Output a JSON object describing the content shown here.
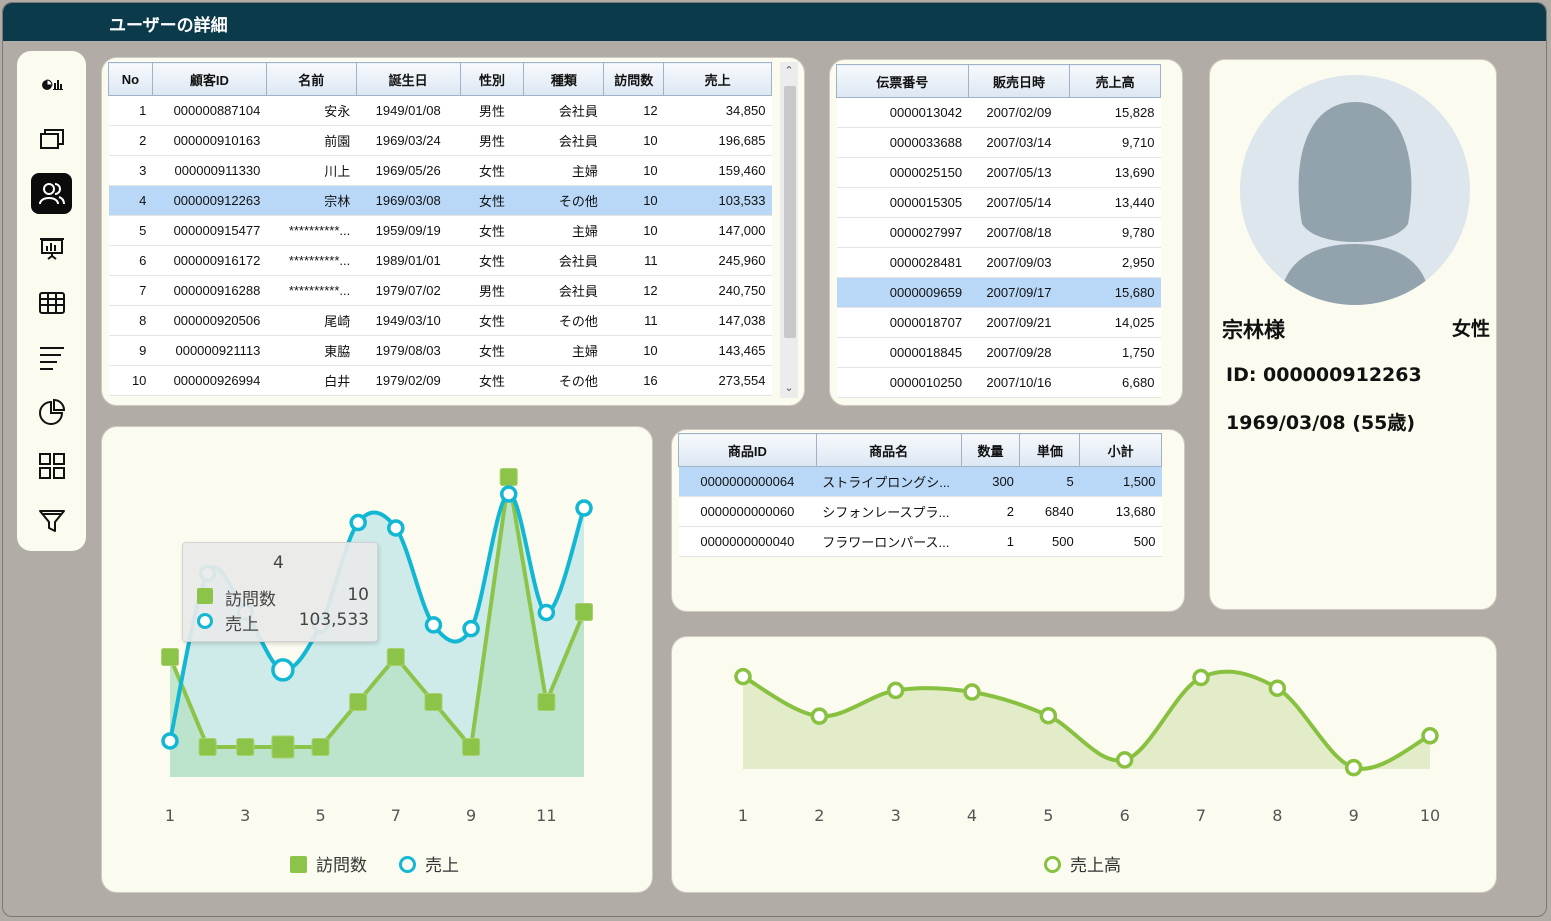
{
  "window": {
    "title": "ユーザーの詳細"
  },
  "sidebar": {
    "items": [
      {
        "icon": "chart-mini-icon",
        "active": false
      },
      {
        "icon": "windows-icon",
        "active": false
      },
      {
        "icon": "users-icon",
        "active": true
      },
      {
        "icon": "presentation-icon",
        "active": false
      },
      {
        "icon": "table-icon",
        "active": false
      },
      {
        "icon": "lines-icon",
        "active": false
      },
      {
        "icon": "pie-icon",
        "active": false
      },
      {
        "icon": "grid-icon",
        "active": false
      },
      {
        "icon": "filter-icon",
        "active": false
      }
    ]
  },
  "customers": {
    "columns": [
      "No",
      "顧客ID",
      "名前",
      "誕生日",
      "性別",
      "種類",
      "訪問数",
      "売上"
    ],
    "selected_index": 3,
    "rows": [
      [
        "1",
        "000000887104",
        "安永",
        "1949/01/08",
        "男性",
        "会社員",
        "12",
        "34,850"
      ],
      [
        "2",
        "000000910163",
        "前園",
        "1969/03/24",
        "男性",
        "会社員",
        "10",
        "196,685"
      ],
      [
        "3",
        "000000911330",
        "川上",
        "1969/05/26",
        "女性",
        "主婦",
        "10",
        "159,460"
      ],
      [
        "4",
        "000000912263",
        "宗林",
        "1969/03/08",
        "女性",
        "その他",
        "10",
        "103,533"
      ],
      [
        "5",
        "000000915477",
        "**********...",
        "1959/09/19",
        "女性",
        "主婦",
        "10",
        "147,000"
      ],
      [
        "6",
        "000000916172",
        "**********...",
        "1989/01/01",
        "女性",
        "会社員",
        "11",
        "245,960"
      ],
      [
        "7",
        "000000916288",
        "**********...",
        "1979/07/02",
        "男性",
        "会社員",
        "12",
        "240,750"
      ],
      [
        "8",
        "000000920506",
        "尾崎",
        "1949/03/10",
        "女性",
        "その他",
        "11",
        "147,038"
      ],
      [
        "9",
        "000000921113",
        "東脇",
        "1979/08/03",
        "女性",
        "主婦",
        "10",
        "143,465"
      ],
      [
        "10",
        "000000926994",
        "白井",
        "1979/02/09",
        "女性",
        "その他",
        "16",
        "273,554"
      ]
    ]
  },
  "slips": {
    "columns": [
      "伝票番号",
      "販売日時",
      "売上高"
    ],
    "selected_index": 6,
    "rows": [
      [
        "0000013042",
        "2007/02/09",
        "15,828"
      ],
      [
        "0000033688",
        "2007/03/14",
        "9,710"
      ],
      [
        "0000025150",
        "2007/05/13",
        "13,690"
      ],
      [
        "0000015305",
        "2007/05/14",
        "13,440"
      ],
      [
        "0000027997",
        "2007/08/18",
        "9,780"
      ],
      [
        "0000028481",
        "2007/09/03",
        "2,950"
      ],
      [
        "0000009659",
        "2007/09/17",
        "15,680"
      ],
      [
        "0000018707",
        "2007/09/21",
        "14,025"
      ],
      [
        "0000018845",
        "2007/09/28",
        "1,750"
      ],
      [
        "0000010250",
        "2007/10/16",
        "6,680"
      ]
    ]
  },
  "products": {
    "columns": [
      "商品ID",
      "商品名",
      "数量",
      "単価",
      "小計"
    ],
    "selected_index": 0,
    "rows": [
      [
        "0000000000064",
        "ストライプロングシ...",
        "300",
        "5",
        "1,500"
      ],
      [
        "0000000000060",
        "シフォンレースプラ...",
        "2",
        "6840",
        "13,680"
      ],
      [
        "0000000000040",
        "フラワーロンパース...",
        "1",
        "500",
        "500"
      ]
    ]
  },
  "profile": {
    "name": "宗林様",
    "gender": "女性",
    "id_text": "ID: 000000912263",
    "birth_text": "1969/03/08 (55歳)",
    "avatar_icon": "person-silhouette-icon"
  },
  "colors": {
    "visits": "#8cc44a",
    "sales": "#12b8d3",
    "slip_sales": "#88c040"
  },
  "chart_data": [
    {
      "type": "line",
      "x": [
        1,
        2,
        3,
        4,
        5,
        6,
        7,
        8,
        9,
        10,
        11,
        12
      ],
      "x_tick_labels": [
        "1",
        "3",
        "5",
        "7",
        "9",
        "11"
      ],
      "series": [
        {
          "name": "訪問数",
          "style": "area-square-markers",
          "values": [
            12,
            10,
            10,
            10,
            10,
            11,
            12,
            11,
            10,
            16,
            11,
            13
          ]
        },
        {
          "name": "売上",
          "style": "area-circle-markers",
          "values": [
            34850,
            196685,
            159460,
            103533,
            147000,
            245960,
            240750,
            147038,
            143465,
            273554,
            159000,
            260000
          ]
        }
      ],
      "legend": "bottom-center",
      "tooltip": {
        "title": "4",
        "rows": [
          {
            "label": "訪問数",
            "value": "10"
          },
          {
            "label": "売上",
            "value": "103,533"
          }
        ]
      }
    },
    {
      "type": "area",
      "x": [
        1,
        2,
        3,
        4,
        5,
        6,
        7,
        8,
        9,
        10
      ],
      "x_tick_labels": [
        "1",
        "2",
        "3",
        "4",
        "5",
        "6",
        "7",
        "8",
        "9",
        "10"
      ],
      "series": [
        {
          "name": "売上高",
          "values": [
            15828,
            9710,
            13690,
            13440,
            9780,
            2950,
            15680,
            14025,
            1750,
            6680
          ]
        }
      ],
      "legend": "bottom-center"
    }
  ]
}
